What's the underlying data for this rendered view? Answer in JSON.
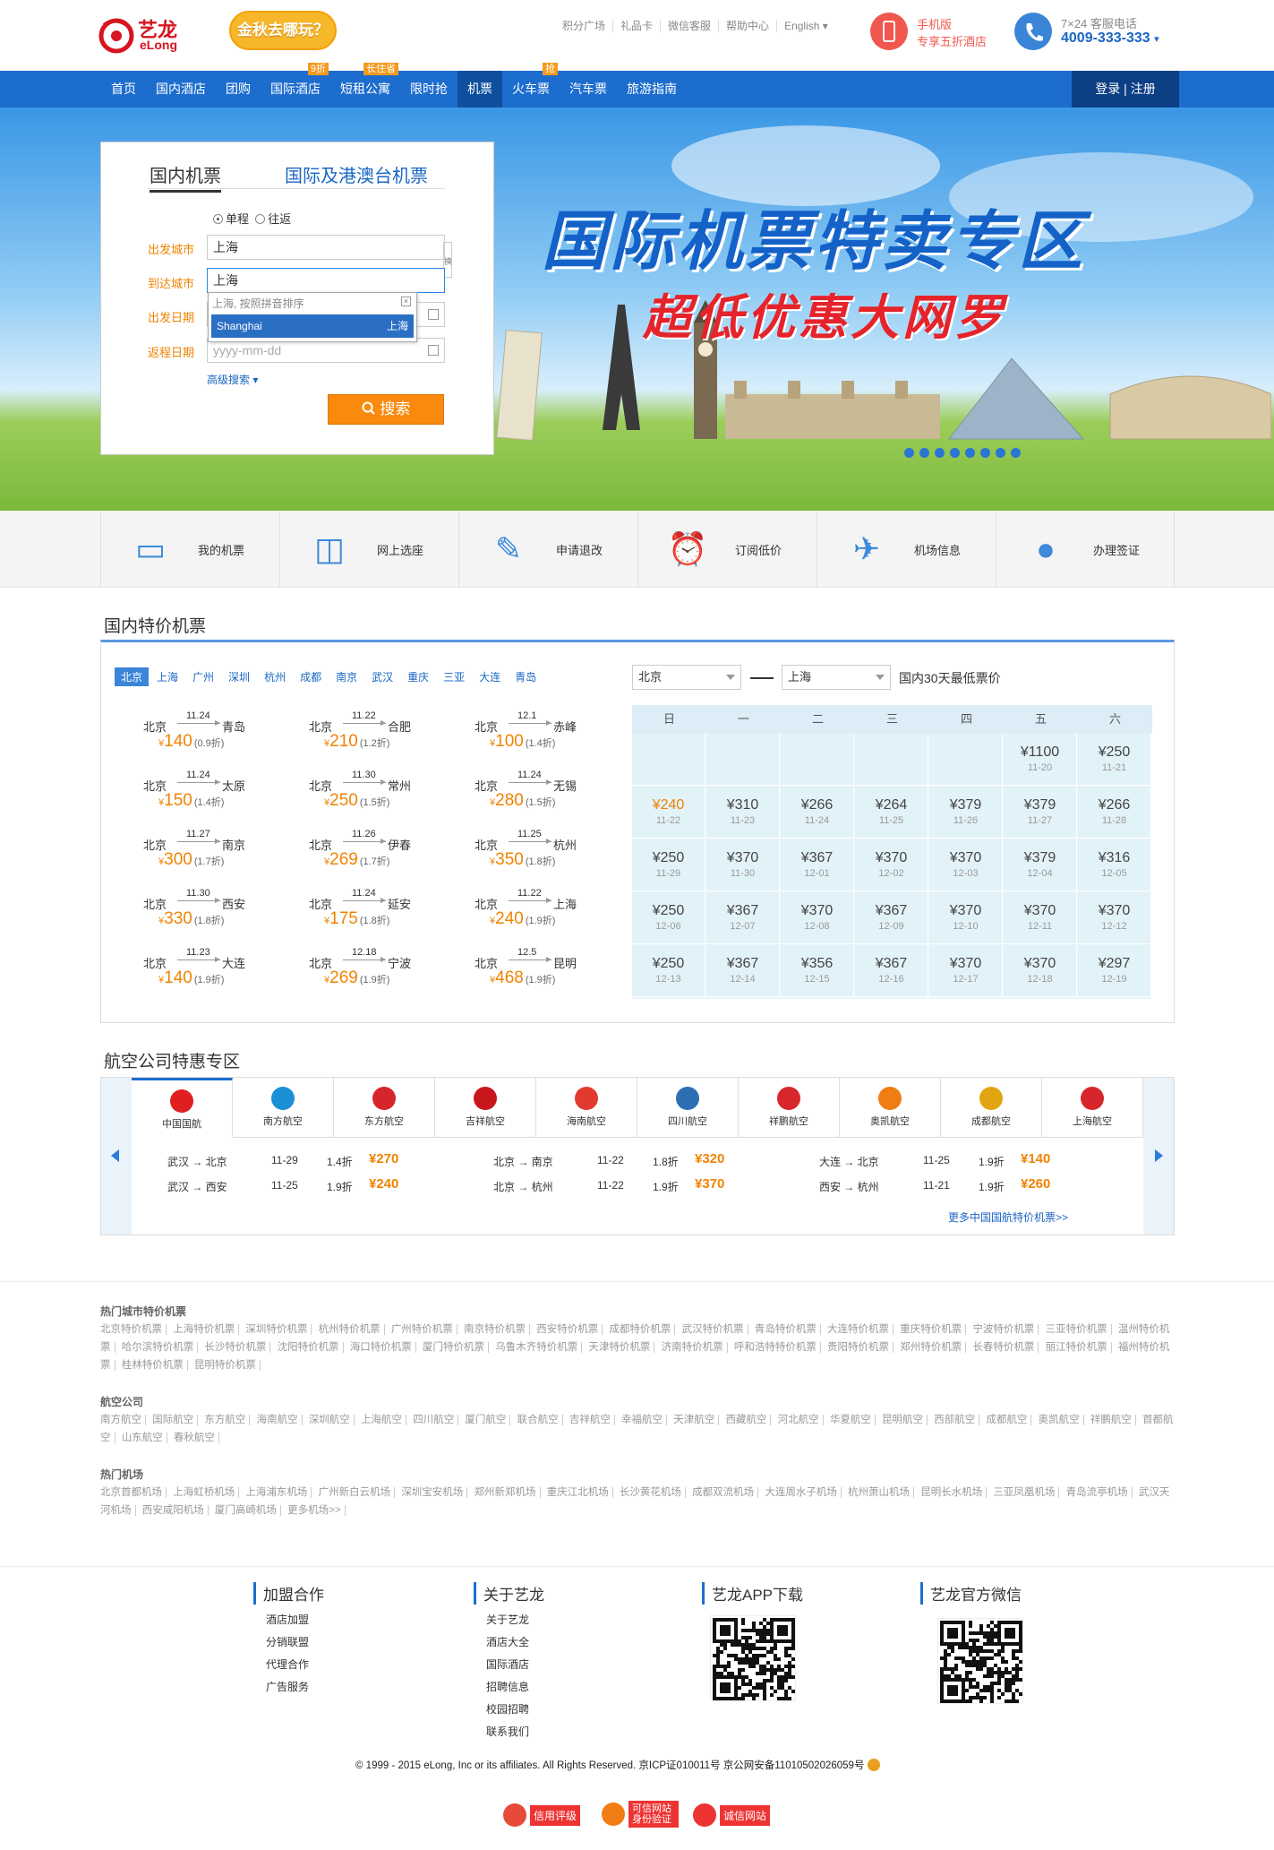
{
  "header": {
    "logo_text": "艺龙",
    "logo_sub": "eLong",
    "promo": "金秋去哪玩？",
    "top_links": [
      "积分广场",
      "礼品卡",
      "微信客服",
      "帮助中心",
      "English"
    ],
    "mobile_line1": "手机版",
    "mobile_line2": "专享五折酒店",
    "phone_label": "7×24 客服电话",
    "phone_number": "4009-333-333"
  },
  "nav": {
    "items": [
      {
        "label": "首页"
      },
      {
        "label": "国内酒店"
      },
      {
        "label": "团购"
      },
      {
        "label": "国际酒店",
        "tag": "9折"
      },
      {
        "label": "短租公寓",
        "tag": "长住省"
      },
      {
        "label": "限时抢"
      },
      {
        "label": "机票"
      },
      {
        "label": "火车票",
        "tag": "抢"
      },
      {
        "label": "汽车票"
      },
      {
        "label": "旅游指南"
      }
    ],
    "login": "登录 | 注册"
  },
  "banner": {
    "title": "国际机票特卖专区",
    "subtitle": "超低优惠大网罗"
  },
  "search": {
    "tab_domestic": "国内机票",
    "tab_intl": "国际及港澳台机票",
    "one_way": "单程",
    "round_trip": "往返",
    "label_from": "出发城市",
    "label_to": "到达城市",
    "label_depart": "出发日期",
    "label_return": "返程日期",
    "from_value": "上海",
    "to_value": "上海",
    "return_placeholder": "yyyy-mm-dd",
    "swap": "换",
    "dropdown_hint": "上海, 按照拼音排序",
    "dropdown_option_en": "Shanghai",
    "dropdown_option_cn": "上海",
    "advanced": "高级搜索",
    "button": "搜索"
  },
  "quicklinks": [
    "我的机票",
    "网上选座",
    "申请退改",
    "订阅低价",
    "机场信息",
    "办理签证"
  ],
  "domestic": {
    "title": "国内特价机票",
    "cities": [
      "北京",
      "上海",
      "广州",
      "深圳",
      "杭州",
      "成都",
      "南京",
      "武汉",
      "重庆",
      "三亚",
      "大连",
      "青岛"
    ],
    "tickets": [
      {
        "from": "北京",
        "to": "青岛",
        "date": "11.24",
        "price": "140",
        "disc": "(0.9折)"
      },
      {
        "from": "北京",
        "to": "合肥",
        "date": "11.22",
        "price": "210",
        "disc": "(1.2折)"
      },
      {
        "from": "北京",
        "to": "赤峰",
        "date": "12.1",
        "price": "100",
        "disc": "(1.4折)"
      },
      {
        "from": "北京",
        "to": "太原",
        "date": "11.24",
        "price": "150",
        "disc": "(1.4折)"
      },
      {
        "from": "北京",
        "to": "常州",
        "date": "11.30",
        "price": "250",
        "disc": "(1.5折)"
      },
      {
        "from": "北京",
        "to": "无锡",
        "date": "11.24",
        "price": "280",
        "disc": "(1.5折)"
      },
      {
        "from": "北京",
        "to": "南京",
        "date": "11.27",
        "price": "300",
        "disc": "(1.7折)"
      },
      {
        "from": "北京",
        "to": "伊春",
        "date": "11.26",
        "price": "269",
        "disc": "(1.7折)"
      },
      {
        "from": "北京",
        "to": "杭州",
        "date": "11.25",
        "price": "350",
        "disc": "(1.8折)"
      },
      {
        "from": "北京",
        "to": "西安",
        "date": "11.30",
        "price": "330",
        "disc": "(1.8折)"
      },
      {
        "from": "北京",
        "to": "延安",
        "date": "11.24",
        "price": "175",
        "disc": "(1.8折)"
      },
      {
        "from": "北京",
        "to": "上海",
        "date": "11.22",
        "price": "240",
        "disc": "(1.9折)"
      },
      {
        "from": "北京",
        "to": "大连",
        "date": "11.23",
        "price": "140",
        "disc": "(1.9折)"
      },
      {
        "from": "北京",
        "to": "宁波",
        "date": "12.18",
        "price": "269",
        "disc": "(1.9折)"
      },
      {
        "from": "北京",
        "to": "昆明",
        "date": "12.5",
        "price": "468",
        "disc": "(1.9折)"
      }
    ],
    "cal_from": "北京",
    "cal_to": "上海",
    "cal_label": "国内30天最低票价",
    "weekdays": [
      "日",
      "一",
      "二",
      "三",
      "四",
      "五",
      "六"
    ],
    "calendar": [
      [
        null,
        null,
        null,
        null,
        null,
        {
          "p": "¥1100",
          "d": "11-20"
        },
        {
          "p": "¥250",
          "d": "11-21"
        }
      ],
      [
        {
          "p": "¥240",
          "d": "11-22",
          "low": true
        },
        {
          "p": "¥310",
          "d": "11-23"
        },
        {
          "p": "¥266",
          "d": "11-24"
        },
        {
          "p": "¥264",
          "d": "11-25"
        },
        {
          "p": "¥379",
          "d": "11-26"
        },
        {
          "p": "¥379",
          "d": "11-27"
        },
        {
          "p": "¥266",
          "d": "11-28"
        }
      ],
      [
        {
          "p": "¥250",
          "d": "11-29"
        },
        {
          "p": "¥370",
          "d": "11-30"
        },
        {
          "p": "¥367",
          "d": "12-01"
        },
        {
          "p": "¥370",
          "d": "12-02"
        },
        {
          "p": "¥370",
          "d": "12-03"
        },
        {
          "p": "¥379",
          "d": "12-04"
        },
        {
          "p": "¥316",
          "d": "12-05"
        }
      ],
      [
        {
          "p": "¥250",
          "d": "12-06"
        },
        {
          "p": "¥367",
          "d": "12-07"
        },
        {
          "p": "¥370",
          "d": "12-08"
        },
        {
          "p": "¥367",
          "d": "12-09"
        },
        {
          "p": "¥370",
          "d": "12-10"
        },
        {
          "p": "¥370",
          "d": "12-11"
        },
        {
          "p": "¥370",
          "d": "12-12"
        }
      ],
      [
        {
          "p": "¥250",
          "d": "12-13"
        },
        {
          "p": "¥367",
          "d": "12-14"
        },
        {
          "p": "¥356",
          "d": "12-15"
        },
        {
          "p": "¥367",
          "d": "12-16"
        },
        {
          "p": "¥370",
          "d": "12-17"
        },
        {
          "p": "¥370",
          "d": "12-18"
        },
        {
          "p": "¥297",
          "d": "12-19"
        }
      ]
    ]
  },
  "airlines": {
    "title": "航空公司特惠专区",
    "tabs": [
      {
        "name": "中国国航",
        "color": "#e02020"
      },
      {
        "name": "南方航空",
        "color": "#1d8fd6"
      },
      {
        "name": "东方航空",
        "color": "#d6262b"
      },
      {
        "name": "吉祥航空",
        "color": "#c8161d"
      },
      {
        "name": "海南航空",
        "color": "#e23a2f"
      },
      {
        "name": "四川航空",
        "color": "#2c6fb3"
      },
      {
        "name": "祥鹏航空",
        "color": "#d8262d"
      },
      {
        "name": "奥凯航空",
        "color": "#f07d14"
      },
      {
        "name": "成都航空",
        "color": "#e2a512"
      },
      {
        "name": "上海航空",
        "color": "#d6262b"
      }
    ],
    "deals": [
      {
        "route": "武汉 → 北京",
        "date": "11-29",
        "disc": "1.4折",
        "price": "¥270"
      },
      {
        "route": "北京 → 南京",
        "date": "11-22",
        "disc": "1.8折",
        "price": "¥320"
      },
      {
        "route": "大连 → 北京",
        "date": "11-25",
        "disc": "1.9折",
        "price": "¥140"
      },
      {
        "route": "武汉 → 西安",
        "date": "11-25",
        "disc": "1.9折",
        "price": "¥240"
      },
      {
        "route": "北京 → 杭州",
        "date": "11-22",
        "disc": "1.9折",
        "price": "¥370"
      },
      {
        "route": "西安 → 杭州",
        "date": "11-21",
        "disc": "1.9折",
        "price": "¥260"
      }
    ],
    "more": "更多中国国航特价机票>>"
  },
  "links": {
    "hot_title": "热门城市特价机票",
    "hot": [
      "北京特价机票",
      "上海特价机票",
      "深圳特价机票",
      "杭州特价机票",
      "广州特价机票",
      "南京特价机票",
      "西安特价机票",
      "成都特价机票",
      "武汉特价机票",
      "青岛特价机票",
      "大连特价机票",
      "重庆特价机票",
      "宁波特价机票",
      "三亚特价机票",
      "温州特价机票",
      "哈尔滨特价机票",
      "长沙特价机票",
      "沈阳特价机票",
      "海口特价机票",
      "厦门特价机票",
      "乌鲁木齐特价机票",
      "天津特价机票",
      "济南特价机票",
      "呼和浩特特价机票",
      "贵阳特价机票",
      "郑州特价机票",
      "长春特价机票",
      "丽江特价机票",
      "福州特价机票",
      "桂林特价机票",
      "昆明特价机票"
    ],
    "airline_title": "航空公司",
    "airlines": [
      "南方航空",
      "国际航空",
      "东方航空",
      "海南航空",
      "深圳航空",
      "上海航空",
      "四川航空",
      "厦门航空",
      "联合航空",
      "吉祥航空",
      "幸福航空",
      "天津航空",
      "西藏航空",
      "河北航空",
      "华夏航空",
      "昆明航空",
      "西部航空",
      "成都航空",
      "奥凯航空",
      "祥鹏航空",
      "首都航空",
      "山东航空",
      "春秋航空"
    ],
    "airport_title": "热门机场",
    "airports": [
      "北京首都机场",
      "上海虹桥机场",
      "上海浦东机场",
      "广州新白云机场",
      "深圳宝安机场",
      "郑州新郑机场",
      "重庆江北机场",
      "长沙黄花机场",
      "成都双流机场",
      "大连周水子机场",
      "杭州萧山机场",
      "昆明长水机场",
      "三亚凤凰机场",
      "青岛流亭机场",
      "武汉天河机场",
      "西安咸阳机场",
      "厦门高崎机场",
      "更多机场>>"
    ]
  },
  "footer": {
    "col1_title": "加盟合作",
    "col1": [
      "酒店加盟",
      "分销联盟",
      "代理合作",
      "广告服务"
    ],
    "col2_title": "关于艺龙",
    "col2": [
      "关于艺龙",
      "酒店大全",
      "国际酒店",
      "招聘信息",
      "校园招聘",
      "联系我们"
    ],
    "col3_title": "艺龙APP下载",
    "col4_title": "艺龙官方微信",
    "copyright": "© 1999 - 2015 eLong, Inc or its affiliates. All Rights Reserved. 京ICP证010011号 京公网安备11010502026059号",
    "badges": [
      "信用评级",
      "可信网站 身份验证",
      "诚信网站"
    ]
  }
}
